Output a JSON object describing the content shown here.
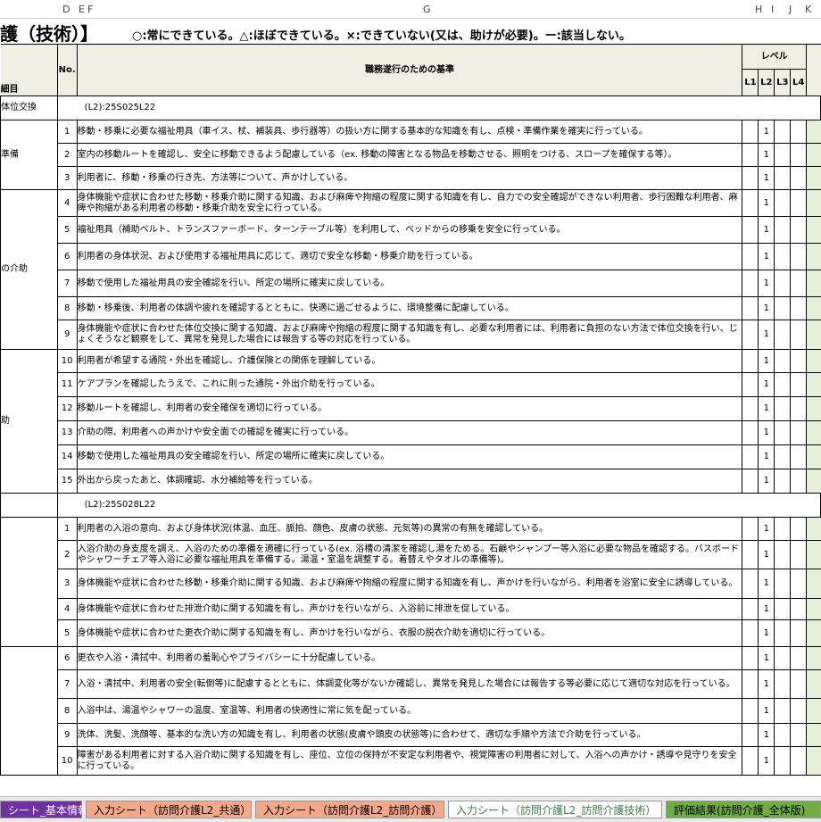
{
  "columns": [
    "D",
    "E",
    "F",
    "G",
    "H",
    "I",
    "J",
    "K"
  ],
  "title": {
    "main": "護（技術）】",
    "legend": "○:常にできている。△:ほぼできている。×:できていない(又は、助けが必要)。ー:該当しない。"
  },
  "header": {
    "item": "細目",
    "no": "No.",
    "criteria": "職務遂行のための基準",
    "level": "レベル",
    "levels": [
      "L1",
      "L2",
      "L3",
      "L4"
    ]
  },
  "sections": [
    {
      "heading": "(L2):25S025L22",
      "cat_label": "体位交換",
      "rows": [
        {
          "no": "1",
          "text": "移動・移乗に必要な福祉用具（車イス、杖、補装具、歩行器等）の扱い方に関する基本的な知識を有し、点検・準備作業を確実に行っている。",
          "lv": "1"
        },
        {
          "no": "2",
          "text": "室内の移動ルートを確認し、安全に移動できるよう配慮している（ex. 移動の障害となる物品を移動させる、照明をつける、スロープを確保する等）。",
          "lv": "1"
        },
        {
          "no": "3",
          "text": "利用者に、移動・移乗の行き先、方法等について、声かけしている。",
          "lv": "1"
        },
        {
          "no": "4",
          "text": "身体機能や症状に合わせた移動・移乗介助に関する知識、および麻痺や拘縮の程度に関する知識を有し、自力での安全確認ができない利用者、歩行困難な利用者、麻痺や拘縮がある利用者の移動・移乗介助を安全に行っている。",
          "lv": "1"
        },
        {
          "no": "5",
          "text": "福祉用具（補助ベルト、トランスファーボード、ターンテーブル等）を利用して、ベッドからの移乗を安全に行っている。",
          "lv": "1"
        },
        {
          "no": "6",
          "text": "利用者の身体状況、および使用する福祉用具に応じて、適切で安全な移動・移乗介助を行っている。",
          "lv": "1"
        },
        {
          "no": "7",
          "text": "移動で使用した福祉用具の安全確認を行い、所定の場所に確実に戻している。",
          "lv": "1"
        },
        {
          "no": "8",
          "text": "移動・移乗後、利用者の体調や疲れを確認するとともに、快適に過ごせるように、環境整備に配慮している。",
          "lv": "1"
        },
        {
          "no": "9",
          "text": "身体機能や症状に合わせた体位交換に関する知識、および麻痺や拘縮の程度に関する知識を有し、必要な利用者には、利用者に負担のない方法で体位交換を行い、じょくそうなど観察をして、異常を発見した場合には報告する等の対応を行っている。",
          "lv": "1"
        },
        {
          "no": "10",
          "text": "利用者が希望する通院・外出を確認し、介護保険との関係を理解している。",
          "lv": "1"
        },
        {
          "no": "11",
          "text": "ケアプランを確認したうえで、これに則った通院・外出介助を行っている。",
          "lv": "1"
        },
        {
          "no": "12",
          "text": "移動ルートを確認し、利用者の安全確保を適切に行っている。",
          "lv": "1"
        },
        {
          "no": "13",
          "text": "介助の際、利用者への声かけや安全面での確認を確実に行っている。",
          "lv": "1"
        },
        {
          "no": "14",
          "text": "移動で使用した福祉用具の安全確認を行い、所定の場所に確実に戻している。",
          "lv": "1"
        },
        {
          "no": "15",
          "text": "外出から戻ったあと、体調確認、水分補給等を行っている。",
          "lv": "1"
        }
      ]
    },
    {
      "heading": "(L2):25S028L22",
      "rows": [
        {
          "no": "1",
          "text": "利用者の入浴の意向、および身体状況(体温、血圧、脈拍、顔色、皮膚の状態、元気等)の異常の有無を確認している。",
          "lv": "1"
        },
        {
          "no": "2",
          "text": "入浴介助の身支度を調え、入浴のための準備を適確に行っている(ex. 浴槽の清潔を確認し湯をためる。石鹸やシャンプー等入浴に必要な物品を確認する。バスボードやシャワーチェア等入浴に必要な福祉用具を準備する。湯温・室温を調整する。着替えやタオルの準備等)。",
          "lv": "1"
        },
        {
          "no": "3",
          "text": "身体機能や症状に合わせた移動・移乗介助に関する知識、および麻痺や拘縮の程度に関する知識を有し、声かけを行いながら、利用者を浴室に安全に誘導している。",
          "lv": "1"
        },
        {
          "no": "4",
          "text": "身体機能や症状に合わせた排泄介助に関する知識を有し、声かけを行いながら、入浴前に排泄を促している。",
          "lv": "1"
        },
        {
          "no": "5",
          "text": "身体機能や症状に合わせた更衣介助に関する知識を有し、声かけを行いながら、衣服の脱衣介助を適切に行っている。",
          "lv": "1"
        },
        {
          "no": "6",
          "text": "更衣や入浴・清拭中、利用者の羞恥心やプライバシーに十分配慮している。",
          "lv": "1"
        },
        {
          "no": "7",
          "text": "入浴・清拭中、利用者の安全(転倒等)に配慮するとともに、体調変化等がないか確認し、異常を発見した場合には報告する等必要に応じて適切な対応を行っている。",
          "lv": "1"
        },
        {
          "no": "8",
          "text": "入浴中は、湯温やシャワーの温度、室温等、利用者の快適性に常に気を配っている。",
          "lv": "1"
        },
        {
          "no": "9",
          "text": "洗体、洗髪、洗顔等、基本的な洗い方の知識を有し、利用者の状態(皮膚や頭皮の状態等)に合わせて、適切な手順や方法で介助を行っている。",
          "lv": "1"
        },
        {
          "no": "10",
          "text": "障害がある利用者に対する入浴介助に関する知識を有し、座位、立位の保持が不安定な利用者や、視覚障害の利用者に対して、入浴への声かけ・誘導や見守りを安全に行っている。",
          "lv": "1"
        }
      ]
    }
  ],
  "side_labels": [
    "準備",
    "の介助",
    "助"
  ],
  "tabs": [
    {
      "label": "シート_基本情報",
      "bg": "#7030a0",
      "fg": "#ffffff"
    },
    {
      "label": "入力シート（訪問介護L2_共通）",
      "bg": "#f4a98a",
      "fg": "#000000"
    },
    {
      "label": "入力シート（訪問介護L2_訪問介護）",
      "bg": "#f4a98a",
      "fg": "#000000"
    },
    {
      "label": "入力シート（訪問介護L2_訪問介護技術）",
      "bg": "#ffffff",
      "fg": "#3a7d44"
    },
    {
      "label": "評価結果(訪問介護_全体版)",
      "bg": "#70ad47",
      "fg": "#000000"
    }
  ]
}
